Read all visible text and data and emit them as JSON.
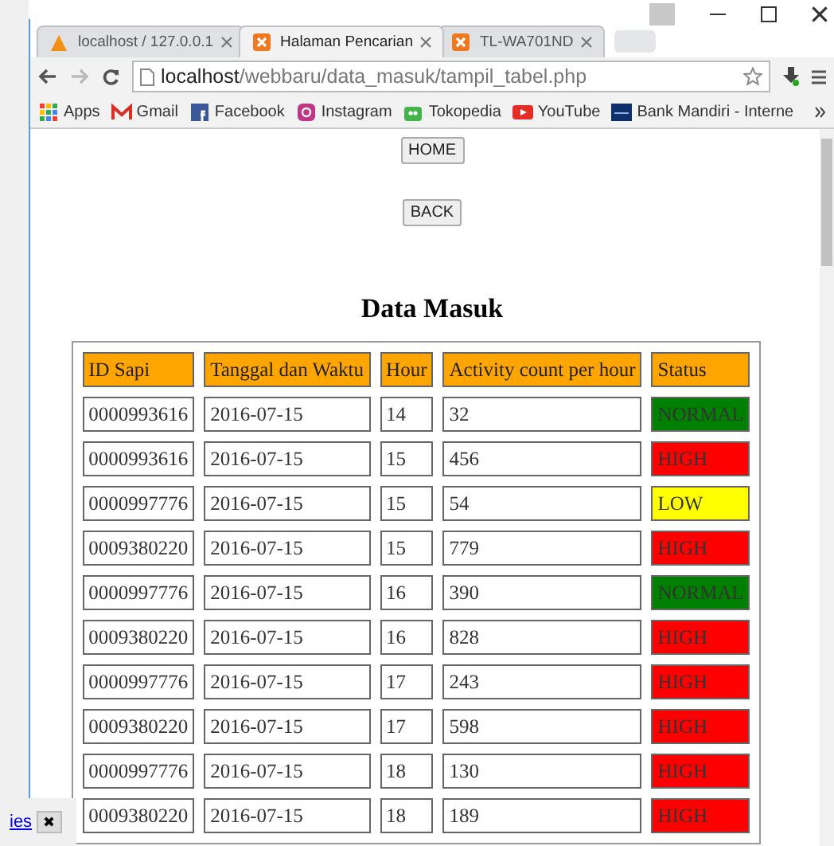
{
  "tabs": [
    {
      "label": "localhost / 127.0.0.1",
      "selected": false
    },
    {
      "label": "Halaman Pencarian",
      "selected": true
    },
    {
      "label": "TL-WA701ND",
      "selected": false
    }
  ],
  "address": {
    "host": "localhost",
    "path": "/webbaru/data_masuk/tampil_tabel.php"
  },
  "bookmarks": [
    "Apps",
    "Gmail",
    "Facebook",
    "Instagram",
    "Tokopedia",
    "YouTube",
    "Bank Mandiri - Interne"
  ],
  "buttons": [
    "HOME",
    "BACK"
  ],
  "heading": "Data Masuk",
  "table": {
    "columns": [
      "ID Sapi",
      "Tanggal dan Waktu",
      "Hour",
      "Activity count per hour",
      "Status"
    ],
    "rows": [
      {
        "id": "0000993616",
        "date": "2016-07-15",
        "hour": "14",
        "count": "32",
        "status": "NORMAL",
        "color": "#008000"
      },
      {
        "id": "0000993616",
        "date": "2016-07-15",
        "hour": "15",
        "count": "456",
        "status": "HIGH",
        "color": "#ff0000"
      },
      {
        "id": "0000997776",
        "date": "2016-07-15",
        "hour": "15",
        "count": "54",
        "status": "LOW",
        "color": "#ffff00"
      },
      {
        "id": "0009380220",
        "date": "2016-07-15",
        "hour": "15",
        "count": "779",
        "status": "HIGH",
        "color": "#ff0000"
      },
      {
        "id": "0000997776",
        "date": "2016-07-15",
        "hour": "16",
        "count": "390",
        "status": "NORMAL",
        "color": "#008000"
      },
      {
        "id": "0009380220",
        "date": "2016-07-15",
        "hour": "16",
        "count": "828",
        "status": "HIGH",
        "color": "#ff0000"
      },
      {
        "id": "0000997776",
        "date": "2016-07-15",
        "hour": "17",
        "count": "243",
        "status": "HIGH",
        "color": "#ff0000"
      },
      {
        "id": "0009380220",
        "date": "2016-07-15",
        "hour": "17",
        "count": "598",
        "status": "HIGH",
        "color": "#ff0000"
      },
      {
        "id": "0000997776",
        "date": "2016-07-15",
        "hour": "18",
        "count": "130",
        "status": "HIGH",
        "color": "#ff0000"
      },
      {
        "id": "0009380220",
        "date": "2016-07-15",
        "hour": "18",
        "count": "189",
        "status": "HIGH",
        "color": "#ff0000"
      }
    ]
  },
  "side_link": "ies",
  "close_glyph": "✖"
}
